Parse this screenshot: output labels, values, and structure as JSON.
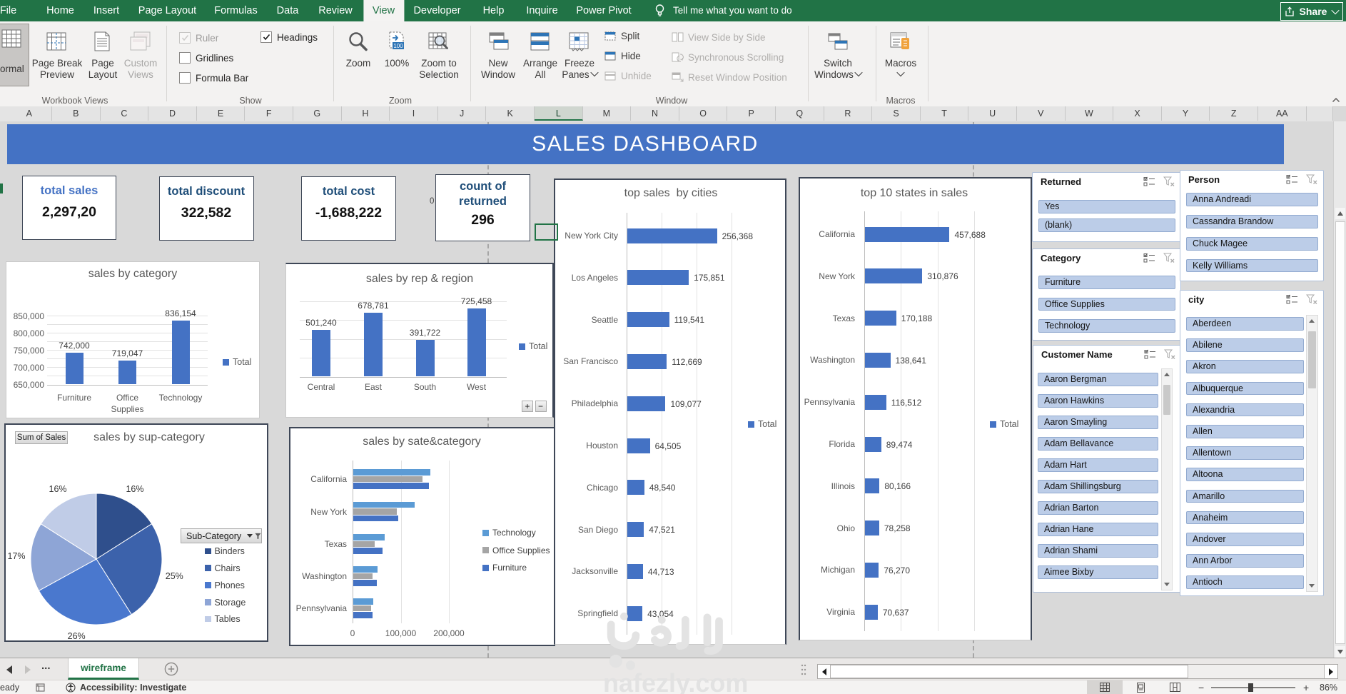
{
  "ribbon": {
    "tabs": [
      "File",
      "Home",
      "Insert",
      "Page Layout",
      "Formulas",
      "Data",
      "Review",
      "View",
      "Developer",
      "Help",
      "Inquire",
      "Power Pivot"
    ],
    "active_tab": "View",
    "tell_me": "Tell me what you want to do",
    "share_label": "Share",
    "group_labels": [
      "Workbook Views",
      "Show",
      "Zoom",
      "Window",
      "Macros"
    ],
    "workbook_views": {
      "normal": "ormal",
      "page_break_preview": [
        "Page Break",
        "Preview"
      ],
      "page_layout": [
        "Page",
        "Layout"
      ],
      "custom_views": [
        "Custom",
        "Views"
      ]
    },
    "show_checkboxes": [
      {
        "label": "Ruler",
        "checked": true,
        "disabled": true
      },
      {
        "label": "Gridlines",
        "checked": false,
        "disabled": false
      },
      {
        "label": "Formula Bar",
        "checked": false,
        "disabled": false
      },
      {
        "label": "Headings",
        "checked": true,
        "disabled": false
      }
    ],
    "zoom_group": {
      "zoom": [
        "Zoom"
      ],
      "zoom_100": [
        "100%"
      ],
      "zoom_to_selection": [
        "Zoom to",
        "Selection"
      ]
    },
    "window_group": {
      "new_window": [
        "New",
        "Window"
      ],
      "arrange_all": [
        "Arrange",
        "All"
      ],
      "freeze_panes": [
        "Freeze",
        "Panes"
      ],
      "split": "Split",
      "hide": "Hide",
      "unhide": "Unhide",
      "view_side_by_side": "View Side by Side",
      "synchronous_scrolling": "Synchronous Scrolling",
      "reset_window_position": "Reset Window Position",
      "switch_windows": [
        "Switch",
        "Windows"
      ]
    },
    "macros_label": "Macros"
  },
  "sheet": {
    "columns": [
      "A",
      "B",
      "C",
      "D",
      "E",
      "F",
      "G",
      "H",
      "I",
      "J",
      "K",
      "L",
      "M",
      "N",
      "O",
      "P",
      "Q",
      "R",
      "S",
      "T",
      "U",
      "V",
      "W",
      "X",
      "Y",
      "Z",
      "AA"
    ],
    "selected_column": "L",
    "stray_cell_text": "0"
  },
  "banner": {
    "title": "SALES DASHBOARD",
    "color": "#4472c4"
  },
  "kpis": [
    {
      "label": "total sales",
      "value": "2,297,20",
      "label_color": "#4472c4"
    },
    {
      "label": "total discount",
      "value": "322,582",
      "label_color": "#1f4e79"
    },
    {
      "label": "total cost",
      "value": "-1,688,222",
      "label_color": "#1f4e79"
    },
    {
      "label": "count of returned",
      "label2": "",
      "value": "296",
      "label_color": "#1f4e79"
    }
  ],
  "chart_data": [
    {
      "id": "category",
      "type": "bar",
      "title": "sales by category",
      "categories": [
        "Furniture",
        "Office Supplies",
        "Technology"
      ],
      "values": [
        742000,
        719047,
        836154
      ],
      "data_labels": [
        "742,000",
        "719,047",
        "836,154"
      ],
      "y_ticks": [
        "850,000",
        "800,000",
        "750,000",
        "700,000",
        "650,000"
      ],
      "ylim": [
        650000,
        850000
      ],
      "legend": [
        "Total"
      ],
      "bar_color": "#4472c4",
      "grid": true
    },
    {
      "id": "rep_region",
      "type": "bar",
      "title": "sales by rep & region",
      "categories": [
        "Central",
        "East",
        "South",
        "West"
      ],
      "values": [
        501240,
        678781,
        391722,
        725458
      ],
      "data_labels": [
        "501,240",
        "678,781",
        "391,722",
        "725,458"
      ],
      "ylim": [
        0,
        800000
      ],
      "legend": [
        "Total"
      ],
      "bar_color": "#4472c4",
      "grid": true,
      "expand_buttons": [
        "+",
        "−"
      ]
    },
    {
      "id": "sup_category",
      "type": "pie",
      "title": "sales by sup-category",
      "field_button": "Sum of Sales",
      "filter_button": "Sub-Category",
      "slices": [
        {
          "name": "Binders",
          "pct": 16,
          "label": "16%",
          "color": "#2f4f8c"
        },
        {
          "name": "Chairs",
          "pct": 25,
          "label": "25%",
          "color": "#3c62ab"
        },
        {
          "name": "Phones",
          "pct": 26,
          "label": "26%",
          "color": "#4a78ce"
        },
        {
          "name": "Storage",
          "pct": 17,
          "label": "17%",
          "color": "#8ea5d6"
        },
        {
          "name": "Tables",
          "pct": 16,
          "label": "16%",
          "color": "#c0cce7"
        }
      ]
    },
    {
      "id": "state_category",
      "type": "hbar_grouped",
      "title": "sales by sate&category",
      "categories": [
        "California",
        "New York",
        "Texas",
        "Washington",
        "Pennsylvania"
      ],
      "series": [
        {
          "name": "Technology",
          "color": "#5b9bd5",
          "values": [
            160000,
            128000,
            65000,
            51000,
            41000
          ]
        },
        {
          "name": "Office Supplies",
          "color": "#a5a5a5",
          "values": [
            144000,
            90000,
            44000,
            40000,
            37000
          ]
        },
        {
          "name": "Furniture",
          "color": "#4472c4",
          "values": [
            157000,
            94000,
            61000,
            49000,
            40000
          ]
        }
      ],
      "x_ticks": [
        "0",
        "100,000",
        "200,000"
      ],
      "xlim": [
        0,
        250000
      ]
    },
    {
      "id": "top_cities",
      "type": "hbar",
      "title": "top sales  by cities",
      "categories": [
        "New York City",
        "Los Angeles",
        "Seattle",
        "San Francisco",
        "Philadelphia",
        "Houston",
        "Chicago",
        "San Diego",
        "Jacksonville",
        "Springfield"
      ],
      "values": [
        256368,
        175851,
        119541,
        112669,
        109077,
        64505,
        48540,
        47521,
        44713,
        43054
      ],
      "data_labels": [
        "256,368",
        "175,851",
        "119,541",
        "112,669",
        "109,077",
        "64,505",
        "48,540",
        "47,521",
        "44,713",
        "43,054"
      ],
      "grid_step": 100000,
      "xlim": [
        0,
        450000
      ],
      "legend": [
        "Total"
      ],
      "bar_color": "#4472c4"
    },
    {
      "id": "top_states",
      "type": "hbar",
      "title": "top 10 states in sales",
      "categories": [
        "California",
        "New York",
        "Texas",
        "Washington",
        "Pennsylvania",
        "Florida",
        "Illinois",
        "Ohio",
        "Michigan",
        "Virginia"
      ],
      "values": [
        457688,
        310876,
        170188,
        138641,
        116512,
        89474,
        80166,
        78258,
        76270,
        70637
      ],
      "data_labels": [
        "457,688",
        "310,876",
        "170,188",
        "138,641",
        "116,512",
        "89,474",
        "80,166",
        "78,258",
        "76,270",
        "70,637"
      ],
      "grid_step": 200000,
      "xlim": [
        0,
        800000
      ],
      "legend": [
        "Total"
      ],
      "bar_color": "#4472c4"
    }
  ],
  "slicers": [
    {
      "id": "returned",
      "title": "Returned",
      "items": [
        "Yes",
        "(blank)"
      ]
    },
    {
      "id": "category",
      "title": "Category",
      "items": [
        "Furniture",
        "Office Supplies",
        "Technology"
      ]
    },
    {
      "id": "customer",
      "title": "Customer Name",
      "items": [
        "Aaron Bergman",
        "Aaron Hawkins",
        "Aaron Smayling",
        "Adam Bellavance",
        "Adam Hart",
        "Adam Shillingsburg",
        "Adrian Barton",
        "Adrian Hane",
        "Adrian Shami",
        "Aimee Bixby"
      ]
    },
    {
      "id": "person",
      "title": "Person",
      "items": [
        "Anna Andreadi",
        "Cassandra Brandow",
        "Chuck Magee",
        "Kelly Williams"
      ]
    },
    {
      "id": "city",
      "title": "city",
      "items": [
        "Aberdeen",
        "Abilene",
        "Akron",
        "Albuquerque",
        "Alexandria",
        "Allen",
        "Allentown",
        "Altoona",
        "Amarillo",
        "Anaheim",
        "Andover",
        "Ann Arbor",
        "Antioch"
      ]
    }
  ],
  "sheet_tabs": {
    "ellipsis": "...",
    "active": "wireframe"
  },
  "status_bar": {
    "ready": "eady",
    "accessibility": "Accessibility: Investigate",
    "zoom_minus": "−",
    "zoom_plus": "+",
    "zoom_pct": "86%"
  },
  "watermark": {
    "domain": "nafezly.com"
  }
}
